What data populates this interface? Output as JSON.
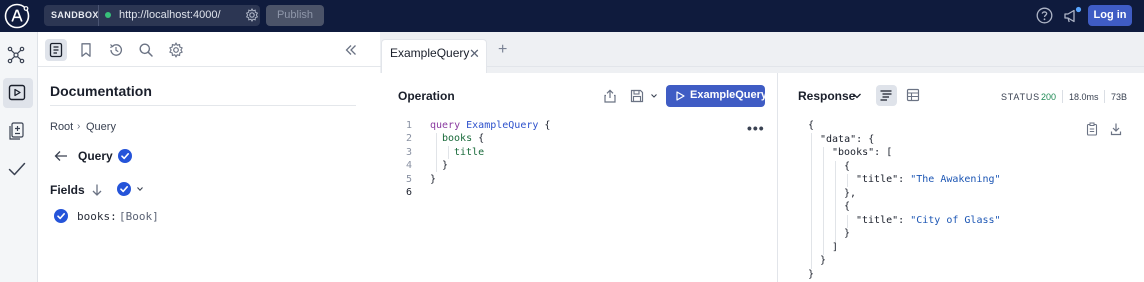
{
  "app": {
    "logo_icon": "apollo-logo-icon",
    "sandbox_label": "SANDBOX",
    "endpoint_url": "http://localhost:4000/",
    "publish_label": "Publish",
    "login_label": "Log in",
    "brand_color": "#0f1b3d",
    "accent_color": "#3f5cc4"
  },
  "rail": {
    "items": [
      {
        "icon": "schema-graph-icon"
      },
      {
        "icon": "explorer-play-icon",
        "active": true
      },
      {
        "icon": "changelog-icon"
      },
      {
        "icon": "checks-icon"
      }
    ]
  },
  "docs": {
    "toolbar_icons": [
      "documentation-icon",
      "bookmark-icon",
      "history-icon",
      "search-icon",
      "settings-icon",
      "collapse-icon"
    ],
    "title": "Documentation",
    "breadcrumb": [
      "Root",
      "Query"
    ],
    "breadcrumb_separator": "›",
    "type_title": "Query",
    "fields_title": "Fields",
    "fields": [
      {
        "name": "books:",
        "type": "[Book]"
      }
    ]
  },
  "editor": {
    "tab_label": "ExampleQuery",
    "close_glyph": "✕",
    "add_glyph": "+",
    "panel_title": "Operation",
    "run_label": "ExampleQuery",
    "more_glyph": "•••",
    "line_numbers": [
      "1",
      "2",
      "3",
      "4",
      "5",
      "6"
    ],
    "code": {
      "kw_query": "query",
      "op_name": "ExampleQuery",
      "open_brace": "{",
      "field_books": "books",
      "field_title": "title",
      "close_brace": "}"
    }
  },
  "response": {
    "title": "Response",
    "status_label": "STATUS",
    "status_code": "200",
    "latency": "18.0ms",
    "size": "73B",
    "status_color": "#1e8a54",
    "json": {
      "open_obj": "{",
      "data_key": "\"data\"",
      "books_key": "\"books\"",
      "title_key": "\"title\"",
      "book1": "\"The Awakening\"",
      "book2": "\"City of Glass\"",
      "colon": ":",
      "open_arr": "[",
      "close_arr": "]",
      "close_obj": "}",
      "close_obj_comma": "},"
    }
  }
}
